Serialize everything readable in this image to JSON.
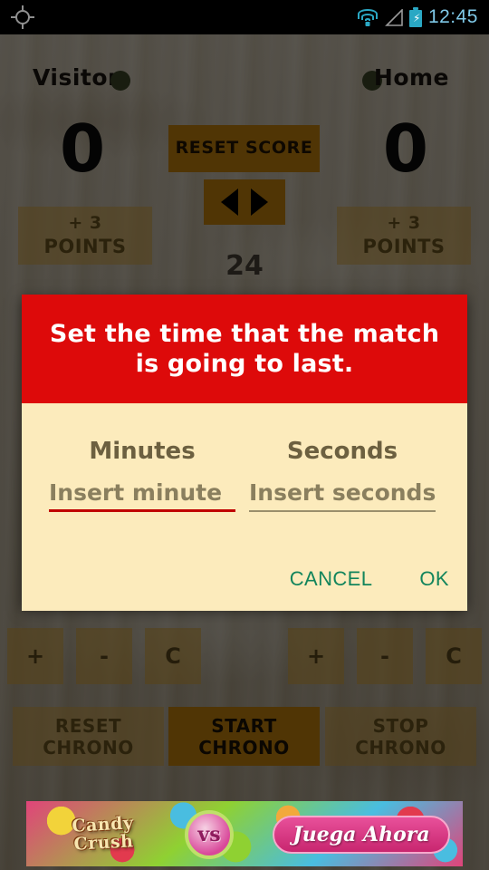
{
  "statusbar": {
    "gps_icon": "gps-crosshair-icon",
    "wifi_icon": "wifi-icon",
    "signal_icon": "signal-triangle-icon",
    "battery_icon": "battery-charging-icon",
    "battery_bolt": "⚡",
    "time": "12:45"
  },
  "scoreboard": {
    "visitor": {
      "label": "Visitor",
      "score": "0",
      "points_line1": "+ 3",
      "points_line2": "POINTS",
      "fouls": [
        "+",
        "-",
        "C"
      ]
    },
    "home": {
      "label": "Home",
      "score": "0",
      "points_line1": "+ 3",
      "points_line2": "POINTS",
      "fouls": [
        "+",
        "-",
        "C"
      ]
    },
    "reset_score_label": "RESET SCORE",
    "arrow_left": "◀",
    "arrow_right": "▶",
    "shot_clock": "24",
    "chrono": {
      "reset_line1": "RESET",
      "reset_line2": "CHRONO",
      "start_line1": "START",
      "start_line2": "CHRONO",
      "stop_line1": "STOP",
      "stop_line2": "CHRONO"
    }
  },
  "dialog": {
    "title": "Set the time that the match is going to last.",
    "minutes_label": "Minutes",
    "minutes_placeholder": "Insert minute",
    "minutes_value": "",
    "seconds_label": "Seconds",
    "seconds_placeholder": "Insert seconds",
    "seconds_value": "",
    "cancel_label": "CANCEL",
    "ok_label": "OK"
  },
  "ad": {
    "logo_line1": "Candy",
    "logo_line2": "Crush",
    "badge": "vs",
    "cta": "Juega Ahora"
  },
  "colors": {
    "dialog_header": "#DD0A0A",
    "dialog_body": "#FCEBBC",
    "accent_amber": "#C8860D",
    "action_green": "#13855C",
    "focus_underline": "#C00000"
  }
}
